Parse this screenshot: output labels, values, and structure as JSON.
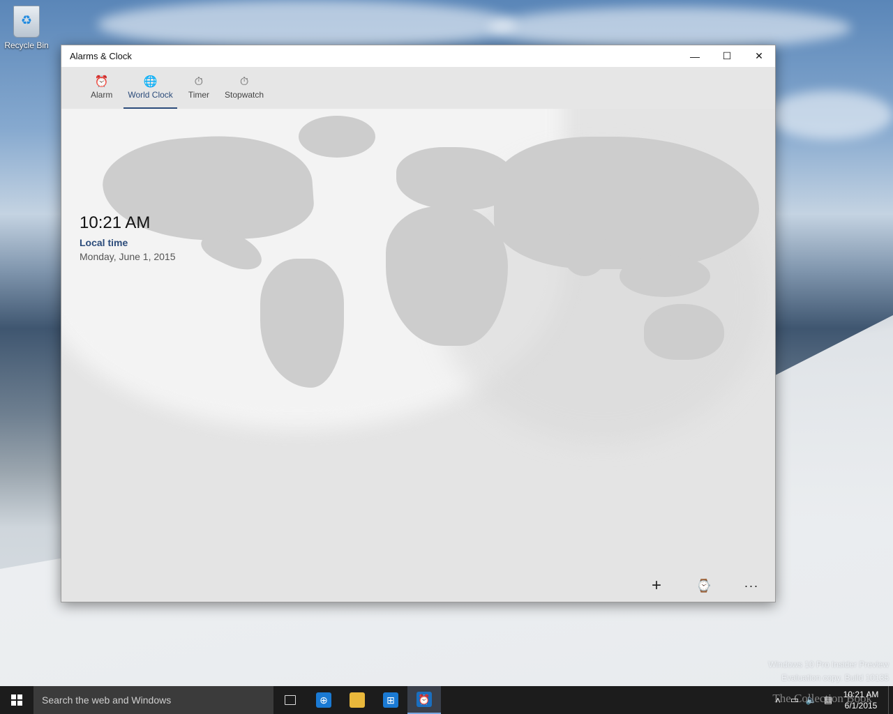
{
  "desktop": {
    "recycle_bin_label": "Recycle Bin"
  },
  "window": {
    "title": "Alarms & Clock",
    "controls": {
      "minimize": "—",
      "maximize": "☐",
      "close": "✕"
    },
    "tabs": [
      {
        "label": "Alarm",
        "icon": "alarm-icon",
        "glyph": "⏰",
        "active": false
      },
      {
        "label": "World Clock",
        "icon": "world-clock-icon",
        "glyph": "🌐",
        "active": true
      },
      {
        "label": "Timer",
        "icon": "timer-icon",
        "glyph": "⏱",
        "active": false
      },
      {
        "label": "Stopwatch",
        "icon": "stopwatch-icon",
        "glyph": "⏱",
        "active": false
      }
    ],
    "local_clock": {
      "time": "10:21 AM",
      "label": "Local time",
      "date": "Monday, June 1, 2015"
    },
    "appbar": {
      "add_glyph": "+",
      "compare_glyph": "⌚",
      "more_glyph": "···"
    }
  },
  "watermark": {
    "line1": "Windows 10 Pro Insider Preview",
    "line2": "Evaluation copy. Build 10135"
  },
  "taskbar": {
    "search_placeholder": "Search the web and Windows",
    "brand_overlay": "The Collection Book",
    "tray_clock": {
      "time": "10:21 AM",
      "date": "6/1/2015"
    }
  },
  "colors": {
    "accent": "#2b4b7a",
    "taskbar": "#1c1c1c"
  }
}
